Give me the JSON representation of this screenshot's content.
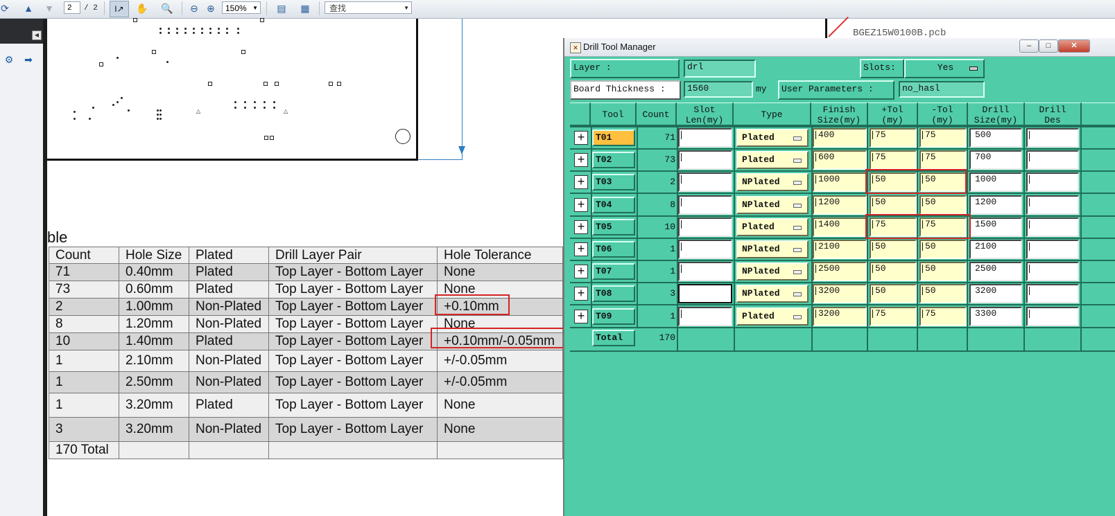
{
  "toolbar": {
    "page_current": "2",
    "page_total": "/ 2",
    "zoom": "150%",
    "find_placeholder": "查找",
    "icons": [
      "up-arrow-icon",
      "down-arrow-icon",
      "select-text-icon",
      "hand-icon",
      "zoom-icon",
      "zoom-out-icon",
      "zoom-in-icon",
      "fit-width-icon",
      "fit-page-icon"
    ]
  },
  "pdf_table": {
    "title_fragment": "ble",
    "headers": [
      "Count",
      "Hole Size",
      "Plated",
      "Drill Layer Pair",
      "Hole Tolerance"
    ],
    "rows": [
      [
        "71",
        "0.40mm",
        "Plated",
        "Top Layer - Bottom Layer",
        "None"
      ],
      [
        "73",
        "0.60mm",
        "Plated",
        "Top Layer - Bottom Layer",
        "None"
      ],
      [
        "2",
        "1.00mm",
        "Non-Plated",
        "Top Layer - Bottom Layer",
        "+0.10mm"
      ],
      [
        "8",
        "1.20mm",
        "Non-Plated",
        "Top Layer - Bottom Layer",
        "None"
      ],
      [
        "10",
        "1.40mm",
        "Plated",
        "Top Layer - Bottom Layer",
        "+0.10mm/-0.05mm"
      ],
      [
        "1",
        "2.10mm",
        "Non-Plated",
        "Top Layer - Bottom Layer",
        "+/-0.05mm"
      ],
      [
        "1",
        "2.50mm",
        "Non-Plated",
        "Top Layer - Bottom Layer",
        "+/-0.05mm"
      ],
      [
        "1",
        "3.20mm",
        "Plated",
        "Top Layer - Bottom Layer",
        "None"
      ],
      [
        "3",
        "3.20mm",
        "Non-Plated",
        "Top Layer - Bottom Layer",
        "None"
      ],
      [
        "170 Total",
        "",
        "",
        "",
        ""
      ]
    ]
  },
  "background_file": "BGEZ15W0100B.pcb",
  "dtm": {
    "title": "Drill Tool Manager",
    "layer_label": "Layer           :",
    "layer_value": "drl",
    "slots_label": "Slots:",
    "slots_value": "Yes",
    "board_thickness_label": "Board Thickness :",
    "board_thickness_value": "1560",
    "board_thickness_unit": "my",
    "user_params_label": "User Parameters :",
    "user_params_value": "no_hasl",
    "headers": {
      "tool": "Tool",
      "count": "Count",
      "slot1": "Slot",
      "slot2": "Len(my)",
      "type": "Type",
      "finish1": "Finish",
      "finish2": "Size(my)",
      "ptol1": "+Tol",
      "ptol2": "(my)",
      "mtol1": "-Tol",
      "mtol2": "(my)",
      "drill1": "Drill",
      "drill2": "Size(my)",
      "des1": "Drill",
      "des2": "Des"
    },
    "tools": [
      {
        "tool": "T01",
        "count": "71",
        "type": "Plated",
        "finish": "400",
        "ptol": "75",
        "mtol": "75",
        "drill": "500"
      },
      {
        "tool": "T02",
        "count": "73",
        "type": "Plated",
        "finish": "600",
        "ptol": "75",
        "mtol": "75",
        "drill": "700"
      },
      {
        "tool": "T03",
        "count": "2",
        "type": "NPlated",
        "finish": "1000",
        "ptol": "50",
        "mtol": "50",
        "drill": "1000"
      },
      {
        "tool": "T04",
        "count": "8",
        "type": "NPlated",
        "finish": "1200",
        "ptol": "50",
        "mtol": "50",
        "drill": "1200"
      },
      {
        "tool": "T05",
        "count": "10",
        "type": "Plated",
        "finish": "1400",
        "ptol": "75",
        "mtol": "75",
        "drill": "1500"
      },
      {
        "tool": "T06",
        "count": "1",
        "type": "NPlated",
        "finish": "2100",
        "ptol": "50",
        "mtol": "50",
        "drill": "2100"
      },
      {
        "tool": "T07",
        "count": "1",
        "type": "NPlated",
        "finish": "2500",
        "ptol": "50",
        "mtol": "50",
        "drill": "2500"
      },
      {
        "tool": "T08",
        "count": "3",
        "type": "NPlated",
        "finish": "3200",
        "ptol": "50",
        "mtol": "50",
        "drill": "3200"
      },
      {
        "tool": "T09",
        "count": "1",
        "type": "Plated",
        "finish": "3200",
        "ptol": "75",
        "mtol": "75",
        "drill": "3300"
      }
    ],
    "total_label": "Total",
    "total_value": "170"
  }
}
